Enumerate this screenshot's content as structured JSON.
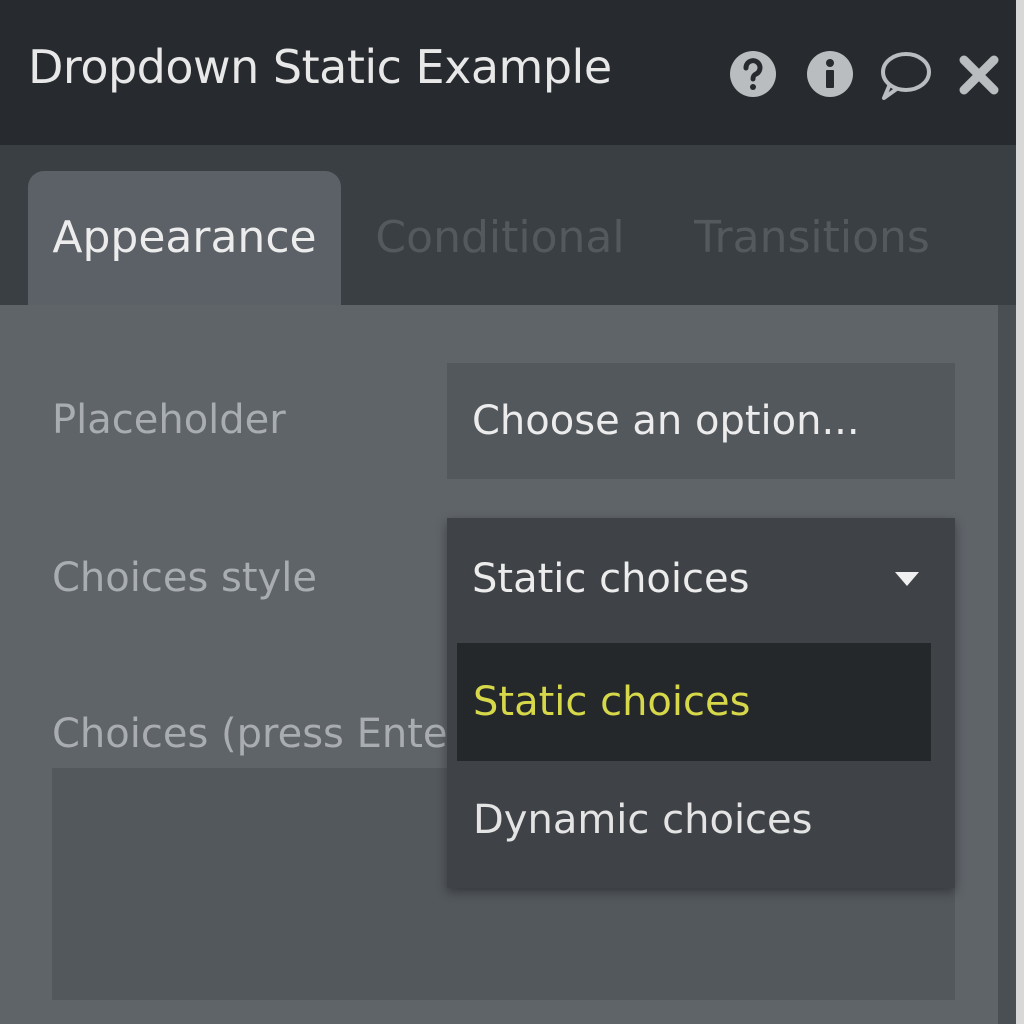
{
  "window": {
    "title": "Dropdown Static Example",
    "icons": {
      "help": "question-circle-icon",
      "info": "info-circle-icon",
      "comment": "speech-bubble-icon",
      "close": "close-icon"
    }
  },
  "tabs": [
    {
      "label": "Appearance",
      "active": true
    },
    {
      "label": "Conditional",
      "active": false
    },
    {
      "label": "Transitions",
      "active": false
    }
  ],
  "form": {
    "placeholder_label": "Placeholder",
    "placeholder_value": "Choose an option...",
    "choices_style_label": "Choices style",
    "choices_style_value": "Static choices",
    "choices_label": "Choices (press Enter be",
    "choices_value": ""
  },
  "dropdown": {
    "options": [
      {
        "label": "Static choices",
        "highlighted": true
      },
      {
        "label": "Dynamic choices",
        "highlighted": false
      }
    ]
  },
  "colors": {
    "titlebar_bg": "#272b2f",
    "panel_bg": "#5f6469",
    "highlight_text": "#d6d84a"
  }
}
